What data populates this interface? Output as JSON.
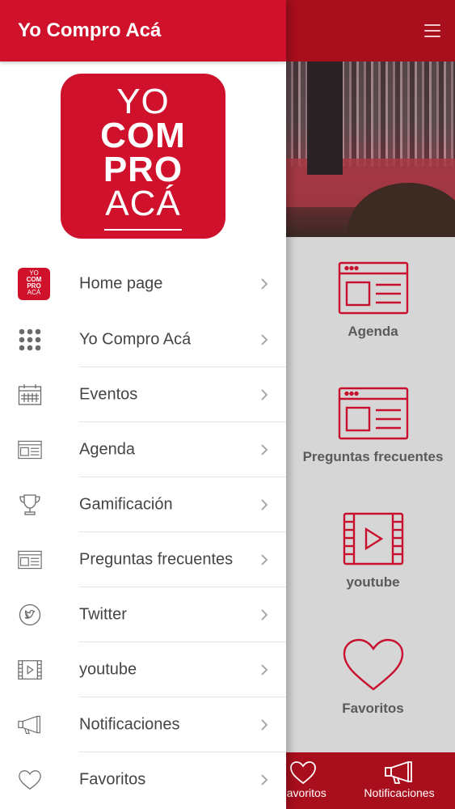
{
  "drawer": {
    "title": "Yo Compro Acá",
    "logo_lines": [
      "YO",
      "COM",
      "PRO",
      "ACÁ"
    ],
    "mini_logo_lines": [
      "YO",
      "COM",
      "PRO",
      "ACÁ"
    ],
    "items": [
      {
        "label": "Home page",
        "icon": "app-logo-icon"
      },
      {
        "label": "Yo Compro Acá",
        "icon": "grid-dots-icon"
      },
      {
        "label": "Eventos",
        "icon": "calendar-icon"
      },
      {
        "label": "Agenda",
        "icon": "browser-window-icon"
      },
      {
        "label": "Gamificación",
        "icon": "trophy-icon"
      },
      {
        "label": "Preguntas frecuentes",
        "icon": "browser-window-icon"
      },
      {
        "label": "Twitter",
        "icon": "twitter-icon"
      },
      {
        "label": "youtube",
        "icon": "video-film-icon"
      },
      {
        "label": "Notificaciones",
        "icon": "megaphone-icon"
      },
      {
        "label": "Favoritos",
        "icon": "heart-icon"
      }
    ]
  },
  "main": {
    "tiles": [
      {
        "label": "Agenda",
        "icon": "browser-window-icon"
      },
      {
        "label": "Preguntas frecuentes",
        "icon": "browser-window-icon"
      },
      {
        "label": "youtube",
        "icon": "video-film-icon"
      },
      {
        "label": "Favoritos",
        "icon": "heart-icon"
      }
    ]
  },
  "tabbar": {
    "tabs": [
      {
        "label": "Favoritos",
        "icon": "heart-icon"
      },
      {
        "label": "Notificaciones",
        "icon": "megaphone-icon"
      }
    ]
  },
  "colors": {
    "drawer_header": "#d0112b",
    "app_header": "#a90e1d",
    "tile_icon": "#c8102e"
  }
}
